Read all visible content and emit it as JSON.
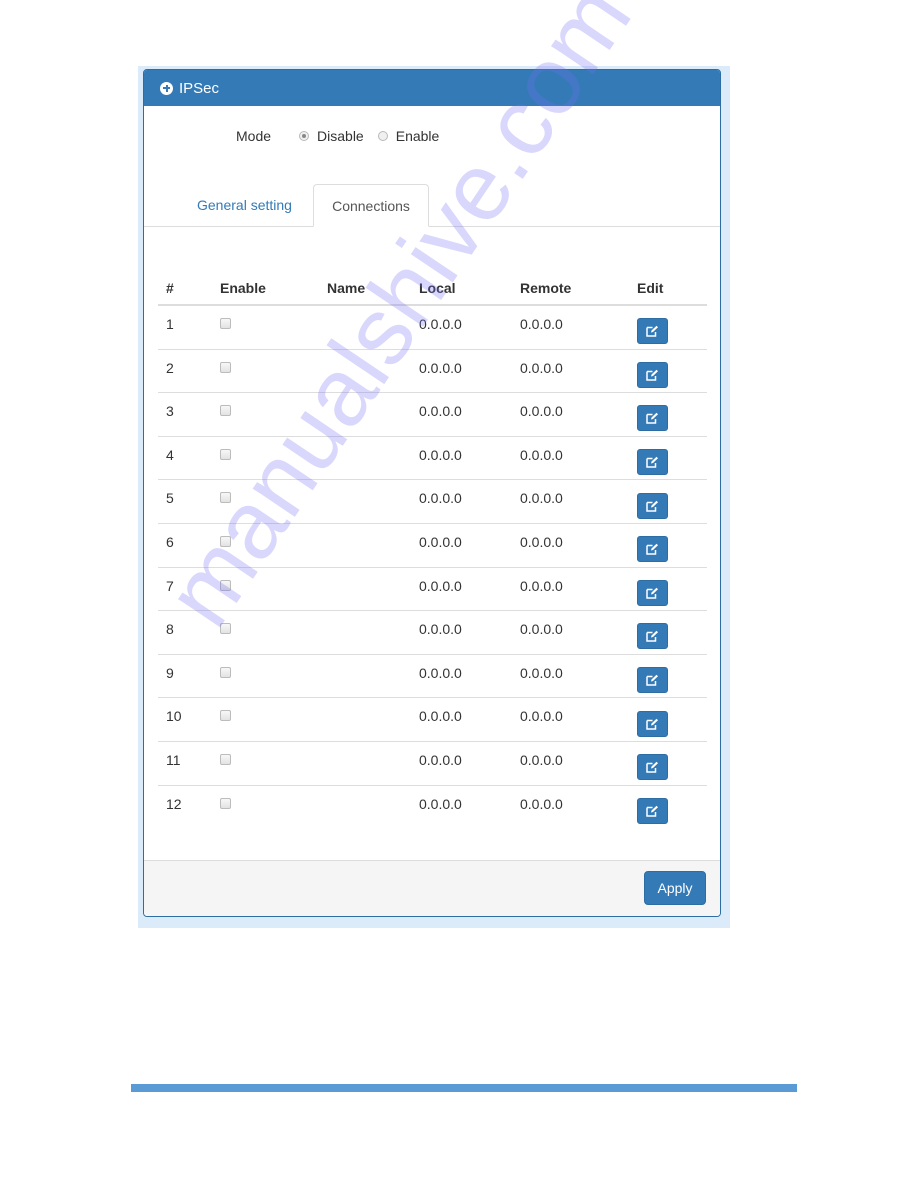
{
  "panel": {
    "title": "IPSec",
    "header_icon": "plus-circle-icon"
  },
  "mode": {
    "label": "Mode",
    "options": [
      {
        "label": "Disable",
        "checked": true
      },
      {
        "label": "Enable",
        "checked": false
      }
    ]
  },
  "tabs": [
    {
      "label": "General setting",
      "active": false
    },
    {
      "label": "Connections",
      "active": true
    }
  ],
  "table": {
    "headers": [
      "#",
      "Enable",
      "Name",
      "Local",
      "Remote",
      "Edit"
    ],
    "rows": [
      {
        "num": "1",
        "enabled": false,
        "name": "",
        "local": "0.0.0.0",
        "remote": "0.0.0.0"
      },
      {
        "num": "2",
        "enabled": false,
        "name": "",
        "local": "0.0.0.0",
        "remote": "0.0.0.0"
      },
      {
        "num": "3",
        "enabled": false,
        "name": "",
        "local": "0.0.0.0",
        "remote": "0.0.0.0"
      },
      {
        "num": "4",
        "enabled": false,
        "name": "",
        "local": "0.0.0.0",
        "remote": "0.0.0.0"
      },
      {
        "num": "5",
        "enabled": false,
        "name": "",
        "local": "0.0.0.0",
        "remote": "0.0.0.0"
      },
      {
        "num": "6",
        "enabled": false,
        "name": "",
        "local": "0.0.0.0",
        "remote": "0.0.0.0"
      },
      {
        "num": "7",
        "enabled": false,
        "name": "",
        "local": "0.0.0.0",
        "remote": "0.0.0.0"
      },
      {
        "num": "8",
        "enabled": false,
        "name": "",
        "local": "0.0.0.0",
        "remote": "0.0.0.0"
      },
      {
        "num": "9",
        "enabled": false,
        "name": "",
        "local": "0.0.0.0",
        "remote": "0.0.0.0"
      },
      {
        "num": "10",
        "enabled": false,
        "name": "",
        "local": "0.0.0.0",
        "remote": "0.0.0.0"
      },
      {
        "num": "11",
        "enabled": false,
        "name": "",
        "local": "0.0.0.0",
        "remote": "0.0.0.0"
      },
      {
        "num": "12",
        "enabled": false,
        "name": "",
        "local": "0.0.0.0",
        "remote": "0.0.0.0"
      }
    ],
    "edit_icon": "edit-icon"
  },
  "footer": {
    "apply_label": "Apply"
  },
  "watermark": "manualshive.com",
  "colors": {
    "primary": "#337ab7",
    "page_bar": "#5b9bd5"
  }
}
